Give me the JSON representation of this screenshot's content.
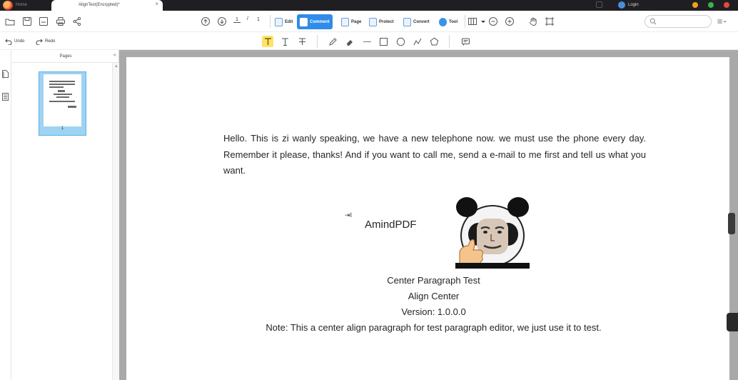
{
  "titlebar": {
    "home_tab": "Home",
    "doc_tab": "AlignTest(Encrypted)*",
    "close_glyph": "×",
    "login_label": "Login"
  },
  "toolbar": {
    "page_current": "1",
    "page_separator": "/",
    "page_total": "1",
    "modes": [
      {
        "label": "Edit",
        "icon": "edit-icon"
      },
      {
        "label": "Comment",
        "icon": "comment-icon"
      },
      {
        "label": "Page",
        "icon": "page-icon"
      },
      {
        "label": "Protect",
        "icon": "protect-icon"
      },
      {
        "label": "Convert",
        "icon": "convert-icon"
      },
      {
        "label": "Tool",
        "icon": "tool-icon"
      }
    ],
    "active_mode": "Comment",
    "accent_color": "#2f8ce8"
  },
  "toolbar2": {
    "undo_label": "Undo",
    "redo_label": "Redo",
    "highlight_color": "#fde36a"
  },
  "pages_panel": {
    "header": "Pages",
    "collapse_glyph": "«",
    "thumb_page_number": "1"
  },
  "document": {
    "paragraph": "Hello. This is zi wanly speaking, we have a new telephone now. we must use the phone every day. Remember it please, thanks! And if you want to call me, send a e-mail to me first and tell us what you want.",
    "logo_text": "AmindPDF",
    "center_lines": [
      "Center Paragraph Test",
      "Align Center",
      "Version: 1.0.0.0",
      "Note: This a center align paragraph for test paragraph editor, we just use it to test."
    ]
  }
}
